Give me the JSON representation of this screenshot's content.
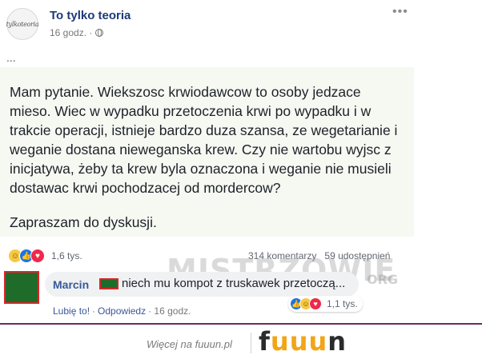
{
  "post": {
    "page_name": "To tylko teoria",
    "avatar_text": "tylkoteoria",
    "time": "16 godz. ·",
    "more_icon": "more-horizontal-icon",
    "ellipsis": "...",
    "text": "Mam pytanie. Wiekszosc krwiodawcow to osoby jedzace\nmieso. Wiec w wypadku przetoczenia krwi po wypadku i w\ntrakcie operacji, istnieje bardzo duza szansa, ze wegetarianie i\nweganie dostana nieweganska krew. Czy nie wartobu wyjsc z\ninicjatywa,  żeby ta krew byla oznaczona i weganie nie musieli\ndostawac krwi pochodzacej od mordercow?",
    "cta": "Zapraszam do dyskusji.",
    "reaction_count": "1,6 tys.",
    "comments_count": "314 komentarzy",
    "shares_count": "59 udostępnień"
  },
  "watermark": {
    "main": "MISTRZOWIE",
    "suffix": "ORG"
  },
  "comment": {
    "author": "Marcin",
    "text": "niech mu kompot z truskawek przetoczą...",
    "reaction_count": "1,1 tys.",
    "like_label": "Lubię to!",
    "separator": "·",
    "reply_label": "Odpowiedz",
    "time": "· 16 godz."
  },
  "footer": {
    "more_text": "Więcej na fuuun.pl",
    "logo_prefix": "f",
    "logo_u1": "u",
    "logo_u2": "u",
    "logo_u3": "u",
    "logo_suffix": "n"
  },
  "colors": {
    "accent": "#385898",
    "post_bg": "#f5f9f2",
    "footer_rule": "#6a2e5e",
    "logo_u": "#f2a516"
  }
}
